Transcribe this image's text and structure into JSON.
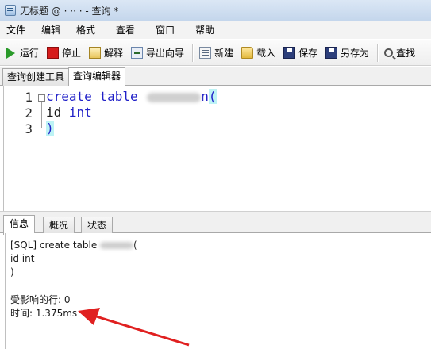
{
  "window": {
    "title": "无标题 @ · ·· · - 查询 *"
  },
  "menu": {
    "items": [
      "文件",
      "编辑",
      "格式",
      "查看",
      "窗口",
      "帮助"
    ]
  },
  "toolbar": {
    "run": "运行",
    "stop": "停止",
    "explain": "解释",
    "export": "导出向导",
    "new": "新建",
    "load": "载入",
    "save": "保存",
    "saveas": "另存为",
    "find": "查找"
  },
  "tabs": {
    "builder": "查询创建工具",
    "editor": "查询编辑器"
  },
  "editor": {
    "lines": [
      {
        "num": "1",
        "kw1": "create",
        "kw2": "table",
        "name_tail": "n",
        "paren": "("
      },
      {
        "num": "2",
        "field": "id",
        "type": "int"
      },
      {
        "num": "3",
        "paren": ")"
      }
    ]
  },
  "bottom_tabs": {
    "info": "信息",
    "summary": "概况",
    "status": "状态"
  },
  "result": {
    "line1_prefix": "[SQL] create table ",
    "line1_suffix": "(",
    "line2": "id int",
    "line3": ")",
    "affected": "受影响的行: 0",
    "time": "时间: 1.375ms"
  },
  "colors": {
    "keyword": "#2020c8",
    "arrow": "#e02020",
    "paren_highlight": "#bdf3f5"
  }
}
